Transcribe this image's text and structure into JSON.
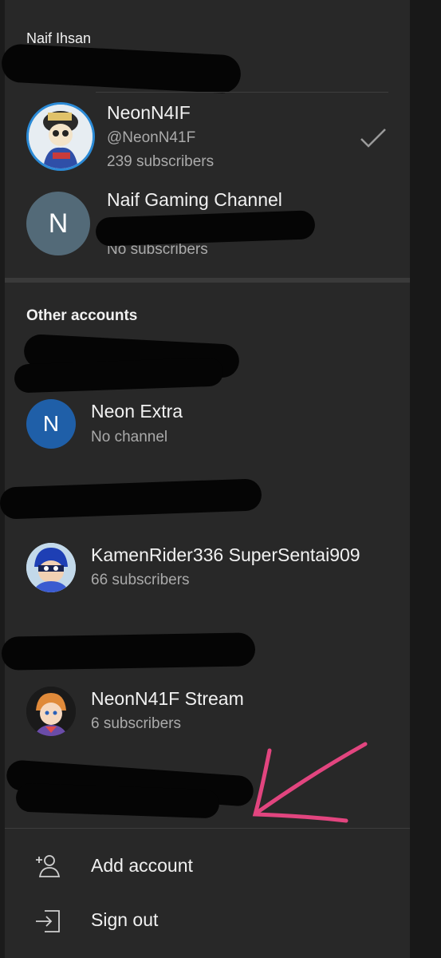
{
  "owner_name": "Naif Ihsan",
  "current_accounts": [
    {
      "name": "NeonN4IF",
      "handle": "@NeonN41F",
      "subscribers": "239 subscribers",
      "selected": true
    },
    {
      "name": "Naif Gaming Channel",
      "avatar_letter": "N",
      "avatar_color": "#536a78",
      "subscribers": "No subscribers"
    }
  ],
  "other_accounts_title": "Other accounts",
  "other_accounts": [
    {
      "name": "Neon Extra",
      "avatar_letter": "N",
      "avatar_color": "#1f5fa8",
      "subtitle": "No channel"
    },
    {
      "name": "KamenRider336 SuperSentai909",
      "subtitle": "66 subscribers"
    },
    {
      "name": "NeonN41F Stream",
      "subtitle": "6 subscribers"
    }
  ],
  "actions": {
    "add_account": "Add account",
    "sign_out": "Sign out"
  },
  "icons": {
    "selected": "checkmark-icon",
    "add_account": "add-person-icon",
    "sign_out": "sign-out-icon"
  },
  "colors": {
    "panel_bg": "#282828",
    "annotation_arrow": "#e2457f"
  }
}
